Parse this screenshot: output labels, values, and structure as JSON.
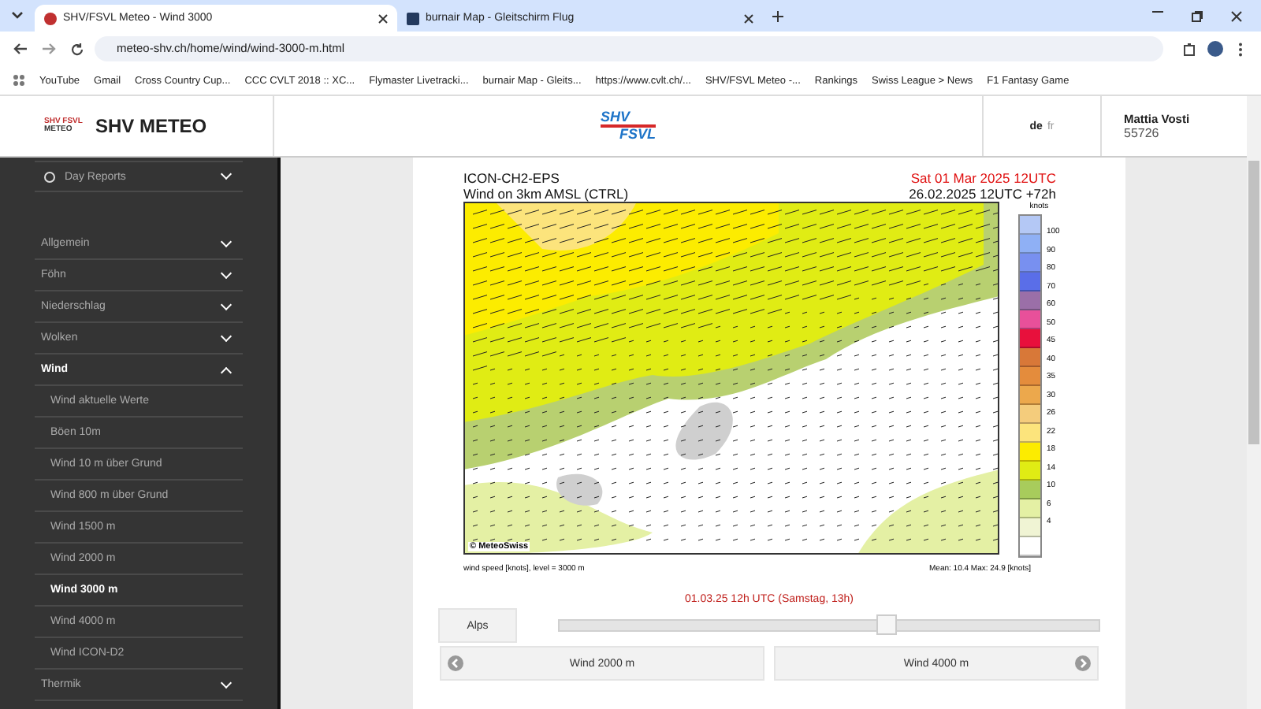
{
  "browser": {
    "tabs": [
      {
        "title": "SHV/FSVL Meteo - Wind 3000",
        "selected": true
      },
      {
        "title": "burnair Map - Gleitschirm Flug",
        "selected": false
      }
    ],
    "url": "meteo-shv.ch/home/wind/wind-3000-m.html",
    "bookmarks": [
      {
        "label": "YouTube"
      },
      {
        "label": "Gmail"
      },
      {
        "label": "Cross Country Cup..."
      },
      {
        "label": "CCC CVLT 2018 :: XC..."
      },
      {
        "label": "Flymaster Livetracki..."
      },
      {
        "label": "burnair Map - Gleits..."
      },
      {
        "label": "https://www.cvlt.ch/..."
      },
      {
        "label": "SHV/FSVL Meteo -..."
      },
      {
        "label": "Rankings"
      },
      {
        "label": "Swiss League > News"
      },
      {
        "label": "F1 Fantasy Game"
      }
    ]
  },
  "header": {
    "logo_small": "SHV FSVL",
    "logo_sub": "METEO",
    "title": "SHV METEO",
    "center_logo_top": "SHV",
    "center_logo_bottom": "FSVL",
    "languages": [
      {
        "label": "de",
        "selected": true
      },
      {
        "label": "fr",
        "selected": false
      }
    ],
    "user_name": "Mattia Vosti",
    "user_id": "55726"
  },
  "sidebar": {
    "day_reports": {
      "label": "Day Reports",
      "expanded": false
    },
    "sections": [
      {
        "label": "Allgemein",
        "expanded": false
      },
      {
        "label": "Föhn",
        "expanded": false
      },
      {
        "label": "Niederschlag",
        "expanded": false
      },
      {
        "label": "Wolken",
        "expanded": false
      },
      {
        "label": "Wind",
        "expanded": true,
        "children": [
          {
            "label": "Wind aktuelle Werte",
            "selected": false
          },
          {
            "label": "Böen 10m",
            "selected": false
          },
          {
            "label": "Wind 10 m über Grund",
            "selected": false
          },
          {
            "label": "Wind 800 m über Grund",
            "selected": false
          },
          {
            "label": "Wind 1500 m",
            "selected": false
          },
          {
            "label": "Wind 2000 m",
            "selected": false
          },
          {
            "label": "Wind 3000 m",
            "selected": true
          },
          {
            "label": "Wind 4000 m",
            "selected": false
          },
          {
            "label": "Wind ICON-D2",
            "selected": false
          }
        ]
      },
      {
        "label": "Thermik",
        "expanded": false
      }
    ]
  },
  "chart": {
    "model": "ICON-CH2-EPS",
    "subtitle": "Wind on 3km AMSL (CTRL)",
    "valid_time": "Sat 01 Mar 2025 12UTC",
    "run_time": "26.02.2025 12UTC +72h",
    "credit": "© MeteoSwiss",
    "legend_title": "knots",
    "legend_boxes": [
      {
        "color": "#b4c8f5"
      },
      {
        "color": "#8fb0f5"
      },
      {
        "color": "#7890f0"
      },
      {
        "color": "#5a6ee8"
      },
      {
        "color": "#9b6fa8"
      },
      {
        "color": "#e8509a"
      },
      {
        "color": "#e8103c"
      },
      {
        "color": "#d87838"
      },
      {
        "color": "#e48c3c"
      },
      {
        "color": "#eca84c"
      },
      {
        "color": "#f4cc7c"
      },
      {
        "color": "#fce47c"
      },
      {
        "color": "#fcec00"
      },
      {
        "color": "#e0ec14"
      },
      {
        "color": "#a8cc5c"
      },
      {
        "color": "#e4f0a4"
      },
      {
        "color": "#f0f4d4"
      },
      {
        "color": "#ffffff"
      }
    ],
    "legend_ticks": [
      "100",
      "90",
      "80",
      "70",
      "60",
      "50",
      "45",
      "40",
      "35",
      "30",
      "26",
      "22",
      "18",
      "14",
      "10",
      "6",
      "4"
    ],
    "footer_left": "wind speed [knots], level = 3000 m",
    "footer_right": "Mean:   10.4 Max:   24.9 [knots]"
  },
  "timestamp": "01.03.25 12h UTC (Samstag, 13h)",
  "slider": {
    "level": 0.61
  },
  "region_button": "Alps",
  "prev_button": "Wind 2000 m",
  "next_button": "Wind 4000 m"
}
